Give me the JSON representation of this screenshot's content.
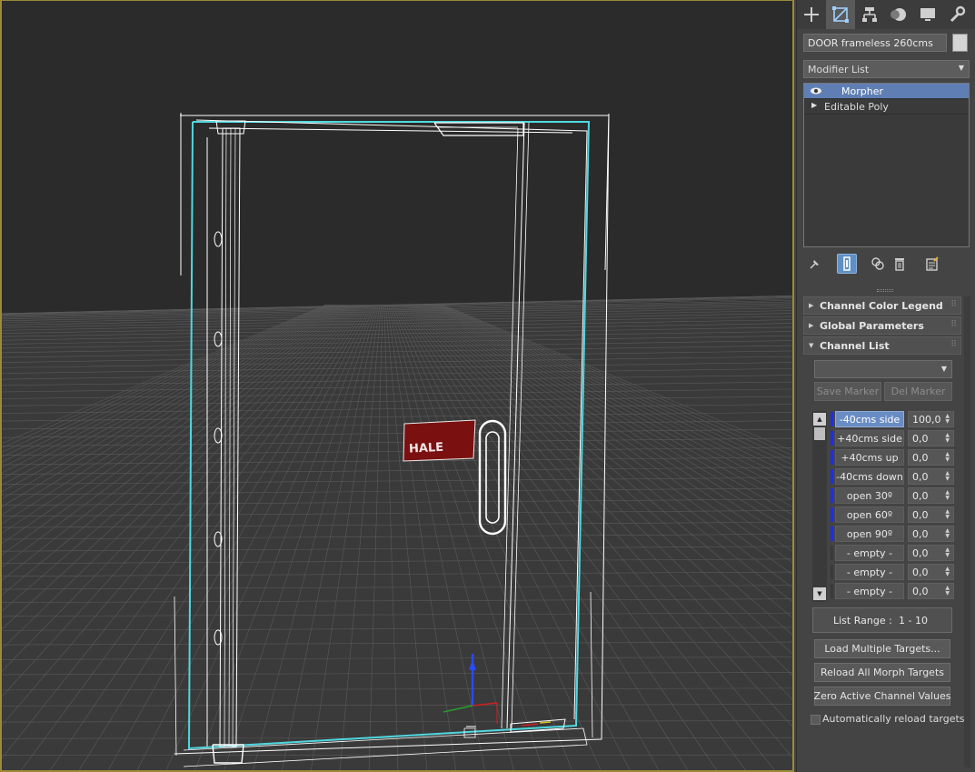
{
  "viewport": {
    "sign_text": "HALE",
    "grid_color": "#5a5a5a",
    "selection_color": "#4fd8e0",
    "wire_color": "#ffffff",
    "sign_color": "#7a1010",
    "border_color": "#9a8a3a"
  },
  "command_panel": {
    "tabs": [
      {
        "icon": "plus-icon",
        "name": "create"
      },
      {
        "icon": "modify-icon",
        "name": "modify",
        "active": true
      },
      {
        "icon": "hierarchy-icon",
        "name": "hierarchy"
      },
      {
        "icon": "motion-icon",
        "name": "motion"
      },
      {
        "icon": "display-icon",
        "name": "display"
      },
      {
        "icon": "wrench-icon",
        "name": "utilities"
      }
    ],
    "object_name": "DOOR frameless 260cms",
    "object_color": "#d4d4d4",
    "modifier_list_label": "Modifier List",
    "stack": [
      {
        "label": "Morpher",
        "selected": true,
        "icon": "eye-icon"
      },
      {
        "label": "Editable Poly",
        "selected": false,
        "icon": "expand-triangle-icon"
      }
    ],
    "stack_tools": [
      "pin-stack-icon",
      "show-end-result-icon",
      "make-unique-icon",
      "remove-modifier-icon",
      "configure-modifier-sets-icon"
    ],
    "rollouts": {
      "channel_color_legend": "Channel Color Legend",
      "global_parameters": "Global Parameters",
      "channel_list": "Channel List"
    },
    "channel_list": {
      "dropdown_value": "",
      "save_marker": "Save Marker",
      "del_marker": "Del Marker",
      "channels": [
        {
          "name": "-40cms side",
          "value": "100,0",
          "selected": true,
          "color": "#1f2fd8"
        },
        {
          "name": "+40cms side",
          "value": "0,0",
          "selected": false,
          "color": "#1f2fd8"
        },
        {
          "name": "+40cms up",
          "value": "0,0",
          "selected": false,
          "color": "#1f2fd8"
        },
        {
          "name": "-40cms down",
          "value": "0,0",
          "selected": false,
          "color": "#1f2fd8"
        },
        {
          "name": "open 30º",
          "value": "0,0",
          "selected": false,
          "color": "#1f2fd8"
        },
        {
          "name": "open 60º",
          "value": "0,0",
          "selected": false,
          "color": "#1f2fd8"
        },
        {
          "name": "open 90º",
          "value": "0,0",
          "selected": false,
          "color": "#1f2fd8"
        },
        {
          "name": "- empty -",
          "value": "0,0",
          "selected": false,
          "color": "#3a3a3a"
        },
        {
          "name": "- empty -",
          "value": "0,0",
          "selected": false,
          "color": "#3a3a3a"
        },
        {
          "name": "- empty -",
          "value": "0,0",
          "selected": false,
          "color": "#3a3a3a"
        }
      ],
      "list_range_label": "List Range :",
      "list_range_value": "1 - 10",
      "load_multiple_targets": "Load Multiple Targets...",
      "reload_all_morph_targets": "Reload All Morph Targets",
      "zero_active_channel_values": "Zero Active Channel Values",
      "auto_reload_label": "Automatically reload targets",
      "auto_reload_checked": false
    }
  }
}
